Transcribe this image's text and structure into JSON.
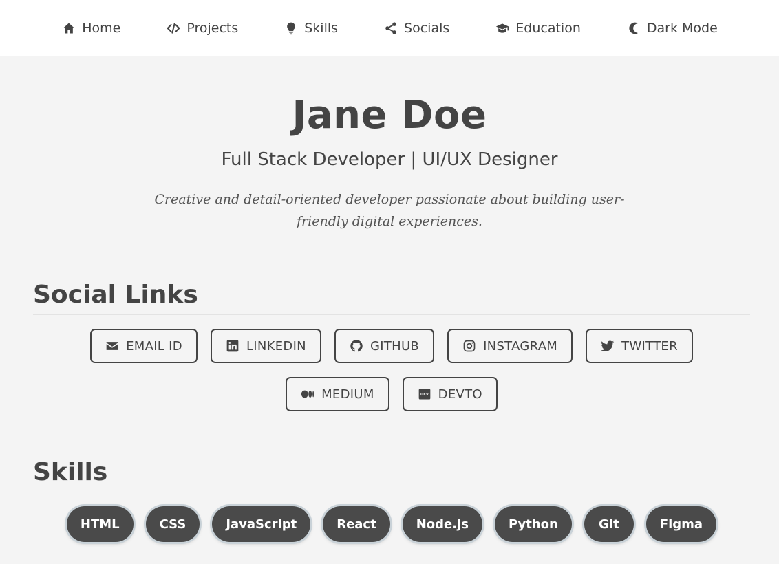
{
  "nav": {
    "items": [
      {
        "label": "Home",
        "icon": "home-icon"
      },
      {
        "label": "Projects",
        "icon": "code-icon"
      },
      {
        "label": "Skills",
        "icon": "lightbulb-icon"
      },
      {
        "label": "Socials",
        "icon": "share-icon"
      },
      {
        "label": "Education",
        "icon": "graduation-cap-icon"
      },
      {
        "label": "Dark Mode",
        "icon": "moon-icon"
      }
    ]
  },
  "hero": {
    "name": "Jane Doe",
    "role": "Full Stack Developer | UI/UX Designer",
    "bio": "Creative and detail-oriented developer passionate about building user-friendly digital experiences."
  },
  "social": {
    "title": "Social Links",
    "links": [
      {
        "label": "EMAIL ID",
        "icon": "email-icon"
      },
      {
        "label": "LINKEDIN",
        "icon": "linkedin-icon"
      },
      {
        "label": "GITHUB",
        "icon": "github-icon"
      },
      {
        "label": "INSTAGRAM",
        "icon": "instagram-icon"
      },
      {
        "label": "TWITTER",
        "icon": "twitter-icon"
      },
      {
        "label": "MEDIUM",
        "icon": "medium-icon"
      },
      {
        "label": "DEVTO",
        "icon": "devto-icon"
      }
    ]
  },
  "skills": {
    "title": "Skills",
    "items": [
      "HTML",
      "CSS",
      "JavaScript",
      "React",
      "Node.js",
      "Python",
      "Git",
      "Figma"
    ]
  },
  "colors": {
    "background": "#f4f4f4",
    "nav_background": "#ffffff",
    "text": "#444444",
    "pill_background": "#4a4a4a",
    "pill_text": "#ffffff"
  }
}
